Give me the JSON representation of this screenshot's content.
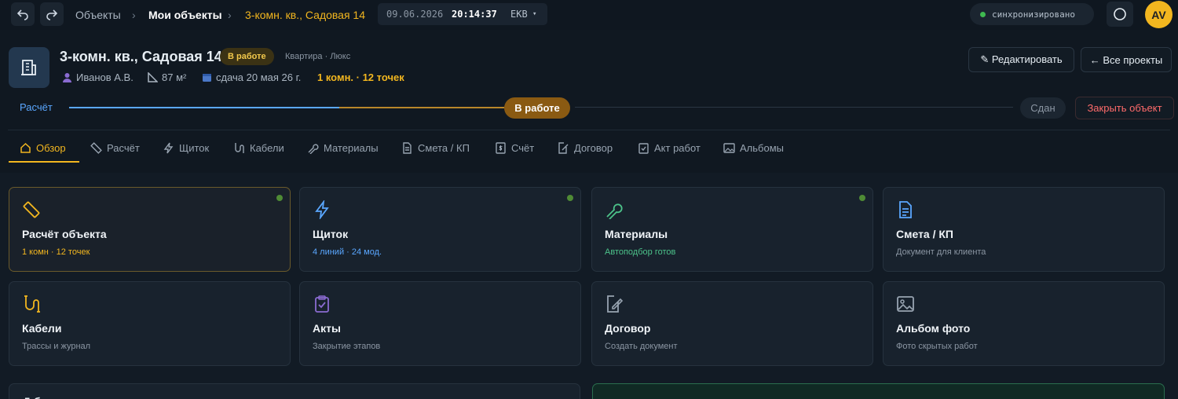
{
  "breadcrumb": {
    "root": "Объекты",
    "my_objects": "Мои объекты",
    "current": "3-комн. кв., Садовая 14"
  },
  "clock": {
    "date": "09.06.2026",
    "time": "20:14:37",
    "tz": "EKB"
  },
  "sync": {
    "label": "синхронизировано"
  },
  "user": {
    "initials": "AV"
  },
  "project": {
    "title": "3-комн. кв., Садовая 14",
    "status_badge": "В работе",
    "type": "Квартира · Люкс",
    "owner": "Иванов А.В.",
    "area": "87 м²",
    "deadline": "сдача 20 мая 26 г.",
    "summary": "1 комн. · 12 точек"
  },
  "actions": {
    "edit": "✎ Редактировать",
    "all_projects": "← Все проекты",
    "close": "Закрыть объект"
  },
  "stages": {
    "first": "Расчёт",
    "current": "В работе",
    "last": "Сдан"
  },
  "tabs": [
    {
      "label": "Обзор",
      "icon": "home-icon"
    },
    {
      "label": "Расчёт",
      "icon": "ruler-icon"
    },
    {
      "label": "Щиток",
      "icon": "bolt-icon"
    },
    {
      "label": "Кабели",
      "icon": "cable-icon"
    },
    {
      "label": "Материалы",
      "icon": "wrench-icon"
    },
    {
      "label": "Смета / КП",
      "icon": "document-icon"
    },
    {
      "label": "Счёт",
      "icon": "invoice-icon"
    },
    {
      "label": "Договор",
      "icon": "pen-document-icon"
    },
    {
      "label": "Акт работ",
      "icon": "clipboard-icon"
    },
    {
      "label": "Альбомы",
      "icon": "image-icon"
    }
  ],
  "cards": [
    {
      "title": "Расчёт объекта",
      "subtitle": "1 комн · 12 точек",
      "icon": "ruler-icon"
    },
    {
      "title": "Щиток",
      "subtitle": "4 линий · 24 мод.",
      "icon": "bolt-icon"
    },
    {
      "title": "Материалы",
      "subtitle": "Автоподбор готов",
      "icon": "wrench-icon"
    },
    {
      "title": "Смета / КП",
      "subtitle": "Документ для клиента",
      "icon": "document-icon"
    },
    {
      "title": "Кабели",
      "subtitle": "Трассы и журнал",
      "icon": "cable-icon"
    },
    {
      "title": "Акты",
      "subtitle": "Закрытие этапов",
      "icon": "clipboard-icon"
    },
    {
      "title": "Договор",
      "subtitle": "Создать документ",
      "icon": "pen-document-icon"
    },
    {
      "title": "Альбом фото",
      "subtitle": "Фото скрытых работ",
      "icon": "image-icon"
    }
  ],
  "bottom": {
    "left_title": "Д            б"
  },
  "colors": {
    "accent": "#f2b61f",
    "blue": "#5aa7ff",
    "green": "#3fb950",
    "danger": "#ff6b6b"
  }
}
